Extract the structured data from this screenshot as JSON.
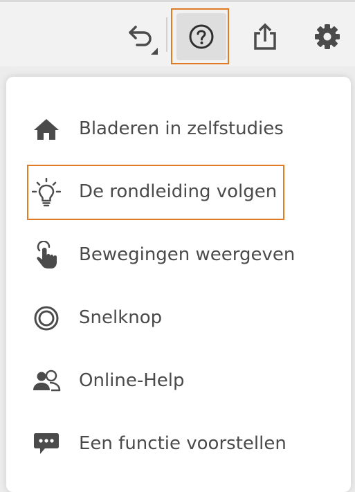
{
  "toolbar": {
    "undo_icon": "undo-icon",
    "help_icon": "help-circle-icon",
    "share_icon": "share-icon",
    "settings_icon": "gear-icon",
    "highlight_color": "#e07a24"
  },
  "help_menu": {
    "items": [
      {
        "label": "Bladeren in zelfstudies",
        "icon": "home-icon"
      },
      {
        "label": "De rondleiding volgen",
        "icon": "lightbulb-icon",
        "highlighted": true
      },
      {
        "label": "Bewegingen weergeven",
        "icon": "touch-gesture-icon"
      },
      {
        "label": "Snelknop",
        "icon": "touch-shortcut-icon"
      },
      {
        "label": "Online-Help",
        "icon": "users-icon"
      },
      {
        "label": "Een functie voorstellen",
        "icon": "speech-bubble-icon"
      }
    ]
  }
}
